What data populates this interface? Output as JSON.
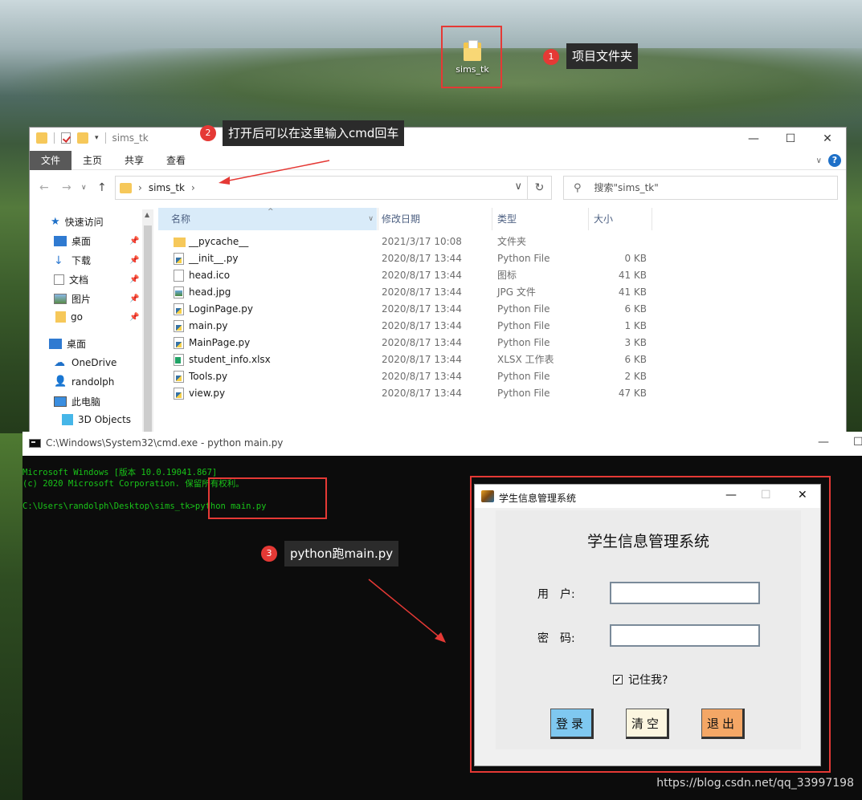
{
  "desktop": {
    "folder_label": "sims_tk"
  },
  "annotations": [
    {
      "number": "1",
      "text": "项目文件夹"
    },
    {
      "number": "2",
      "text": "打开后可以在这里输入cmd回车"
    },
    {
      "number": "3",
      "text": "python跑main.py"
    }
  ],
  "explorer": {
    "title": "sims_tk",
    "ribbon_tabs": [
      "文件",
      "主页",
      "共享",
      "查看"
    ],
    "address": "sims_tk",
    "search_placeholder": "搜索\"sims_tk\"",
    "sidebar": [
      "快速访问",
      "桌面",
      "下载",
      "文档",
      "图片",
      "go",
      "桌面",
      "OneDrive",
      "randolph",
      "此电脑",
      "3D Objects"
    ],
    "columns": [
      "名称",
      "修改日期",
      "类型",
      "大小"
    ],
    "files": [
      {
        "name": "__pycache__",
        "date": "2021/3/17 10:08",
        "type": "文件夹",
        "size": "",
        "icon": "folder"
      },
      {
        "name": "__init__.py",
        "date": "2020/8/17 13:44",
        "type": "Python File",
        "size": "0 KB",
        "icon": "py"
      },
      {
        "name": "head.ico",
        "date": "2020/8/17 13:44",
        "type": "图标",
        "size": "41 KB",
        "icon": "doc"
      },
      {
        "name": "head.jpg",
        "date": "2020/8/17 13:44",
        "type": "JPG 文件",
        "size": "41 KB",
        "icon": "img"
      },
      {
        "name": "LoginPage.py",
        "date": "2020/8/17 13:44",
        "type": "Python File",
        "size": "6 KB",
        "icon": "py"
      },
      {
        "name": "main.py",
        "date": "2020/8/17 13:44",
        "type": "Python File",
        "size": "1 KB",
        "icon": "py"
      },
      {
        "name": "MainPage.py",
        "date": "2020/8/17 13:44",
        "type": "Python File",
        "size": "3 KB",
        "icon": "py"
      },
      {
        "name": "student_info.xlsx",
        "date": "2020/8/17 13:44",
        "type": "XLSX 工作表",
        "size": "6 KB",
        "icon": "xls"
      },
      {
        "name": "Tools.py",
        "date": "2020/8/17 13:44",
        "type": "Python File",
        "size": "2 KB",
        "icon": "py"
      },
      {
        "name": "view.py",
        "date": "2020/8/17 13:44",
        "type": "Python File",
        "size": "47 KB",
        "icon": "py"
      }
    ]
  },
  "cmd": {
    "title": "C:\\Windows\\System32\\cmd.exe - python  main.py",
    "lines": [
      "Microsoft Windows [版本 10.0.19041.867]",
      "(c) 2020 Microsoft Corporation. 保留所有权利。",
      "",
      "C:\\Users\\randolph\\Desktop\\sims_tk>python main.py"
    ]
  },
  "login": {
    "window_title": "学生信息管理系统",
    "heading": "学生信息管理系统",
    "user_label": "用　户:",
    "password_label": "密　码:",
    "remember_label": "记住我?",
    "remember_checked": true,
    "buttons": [
      {
        "label": "登录",
        "color": "#7fc8f0"
      },
      {
        "label": "清空",
        "color": "#fcf6e0"
      },
      {
        "label": "退出",
        "color": "#f4a766"
      }
    ]
  },
  "watermark": "https://blog.csdn.net/qq_33997198",
  "colors": {
    "annotation_red": "#e53935",
    "cmd_text": "#19c419"
  }
}
